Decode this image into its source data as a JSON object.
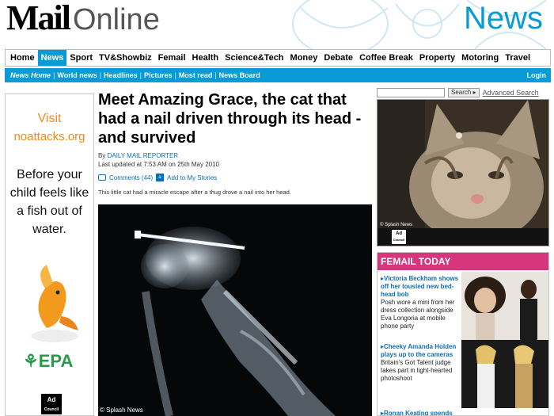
{
  "header": {
    "logo_mail": "Mail",
    "logo_online": "Online",
    "section": "News"
  },
  "mainnav": [
    "Home",
    "News",
    "Sport",
    "TV&Showbiz",
    "Femail",
    "Health",
    "Science&Tech",
    "Money",
    "Debate",
    "Coffee Break",
    "Property",
    "Motoring",
    "Travel"
  ],
  "mainnav_active": "News",
  "subnav": [
    "News Home",
    "World news",
    "Headlines",
    "Pictures",
    "Most read",
    "News Board"
  ],
  "subnav_login": "Login",
  "left_ad": {
    "line1": "Visit",
    "line2": "noattacks.org",
    "body": "Before your child feels like a fish out of water.",
    "epa": "EPA",
    "adc_line1": "Ad",
    "adc_line2": "Council"
  },
  "article": {
    "headline": "Meet Amazing Grace, the cat that had a nail driven through its head - and survived",
    "byline_prefix": "By",
    "author": "DAILY MAIL REPORTER",
    "updated": "Last updated at 7:53 AM on 25th May 2010",
    "comments": "Comments (44)",
    "add_stories": "Add to My Stories",
    "intro": "This little cat had a miracle escape after a thug drove a nail into her head.",
    "image_credit": "© Splash News"
  },
  "search": {
    "button": "Search",
    "advanced": "Advanced Search"
  },
  "cat_photo": {
    "credit": "© Splash News",
    "adc_line1": "Ad",
    "adc_line2": "Council"
  },
  "femail": {
    "title": "FEMAIL TODAY",
    "stories": [
      {
        "title": "Victoria Beckham shows off her tousled new bed-head bob",
        "text": "Posh wore a mini from her dress collection alongside Eva Longoria at mobile phone party"
      },
      {
        "title": "Cheeky Amanda Holden plays up to the cameras",
        "text": "Britain's Got Talent judge takes part in light-hearted photoshoot"
      },
      {
        "title": "Ronan Keating spends",
        "text": ""
      }
    ]
  },
  "colors": {
    "brand_blue": "#0a9ad6",
    "femail_pink": "#d6367c",
    "ad_orange": "#f08a1c",
    "epa_green": "#2a9a4a"
  }
}
